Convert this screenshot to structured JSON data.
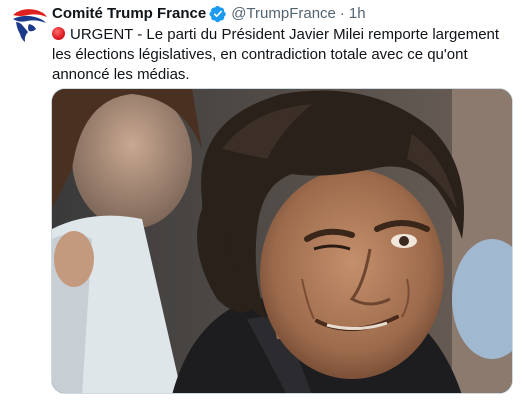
{
  "tweet": {
    "display_name": "Comité Trump France",
    "handle": "@TrumpFrance",
    "separator": "·",
    "time": "1h",
    "text": "URGENT - Le parti du Président Javier Milei remporte largement les élections législatives, en contradiction totale avec ce qu'ont annoncé les médias.",
    "verified": true,
    "status_icon": "red-circle-icon",
    "media_icon": "photo"
  },
  "colors": {
    "text_primary": "#0f1419",
    "text_secondary": "#536471",
    "verified_blue": "#1d9bf0",
    "urgent_red": "#dd1a22",
    "avatar_red": "#e0201f",
    "avatar_blue": "#1b3a8a"
  }
}
